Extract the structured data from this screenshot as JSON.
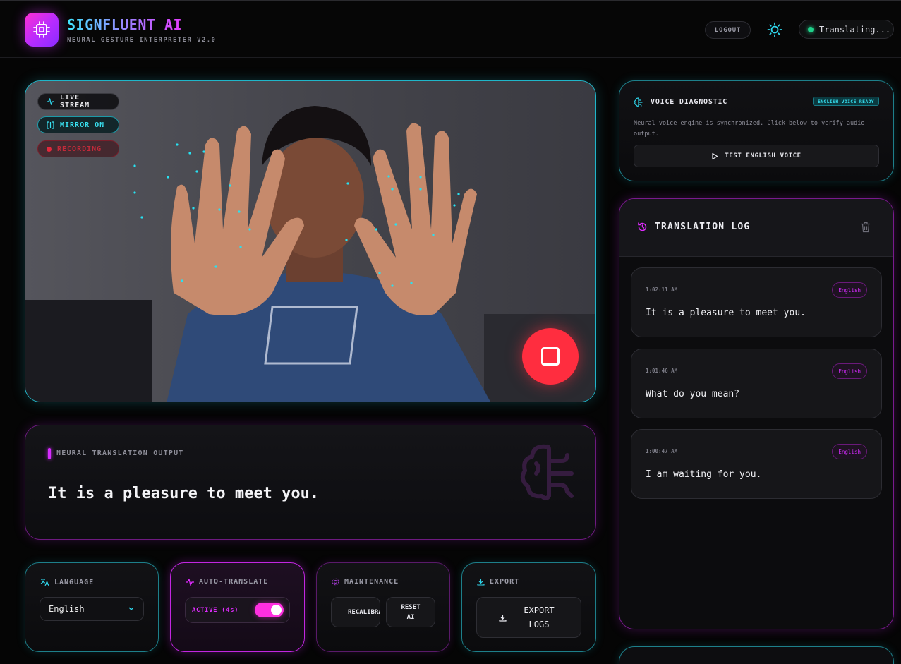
{
  "header": {
    "brand": "SIGNFLUENT AI",
    "tagline": "NEURAL GESTURE INTERPRETER V2.0",
    "logout_label": "LOGOUT",
    "status_text": "Translating...",
    "theme_icon": "sun-icon"
  },
  "video": {
    "live_label": "LIVE STREAM",
    "mirror_label": "MIRROR ON",
    "recording_label": "RECORDING",
    "stop_icon": "stop-icon"
  },
  "output": {
    "label": "NEURAL TRANSLATION OUTPUT",
    "text": "It is a pleasure to meet you."
  },
  "controls": {
    "language": {
      "title": "LANGUAGE",
      "selected": "English"
    },
    "auto_translate": {
      "title": "AUTO-TRANSLATE",
      "status": "ACTIVE (4s)",
      "enabled": true
    },
    "maintenance": {
      "title": "MAINTENANCE",
      "recalibrate_label": "RECALIBRA",
      "reset_label": "RESET AI"
    },
    "export": {
      "title": "EXPORT",
      "button_label": "EXPORT LOGS"
    }
  },
  "voice": {
    "title": "VOICE DIAGNOSTIC",
    "badge": "ENGLISH VOICE READY",
    "description": "Neural voice engine is synchronized. Click below to verify audio output.",
    "button_label": "TEST ENGLISH VOICE"
  },
  "log": {
    "title": "TRANSLATION LOG",
    "entries": [
      {
        "time": "1:02:11 AM",
        "lang": "English",
        "text": "It is a pleasure to meet you."
      },
      {
        "time": "1:01:46 AM",
        "lang": "English",
        "text": "What do you mean?"
      },
      {
        "time": "1:00:47 AM",
        "lang": "English",
        "text": "I am waiting for you."
      }
    ]
  },
  "colors": {
    "accent_cyan": "#1fb6c9",
    "accent_magenta": "#d62cff",
    "record_red": "#ff2d3f",
    "status_green": "#1fd18a"
  }
}
